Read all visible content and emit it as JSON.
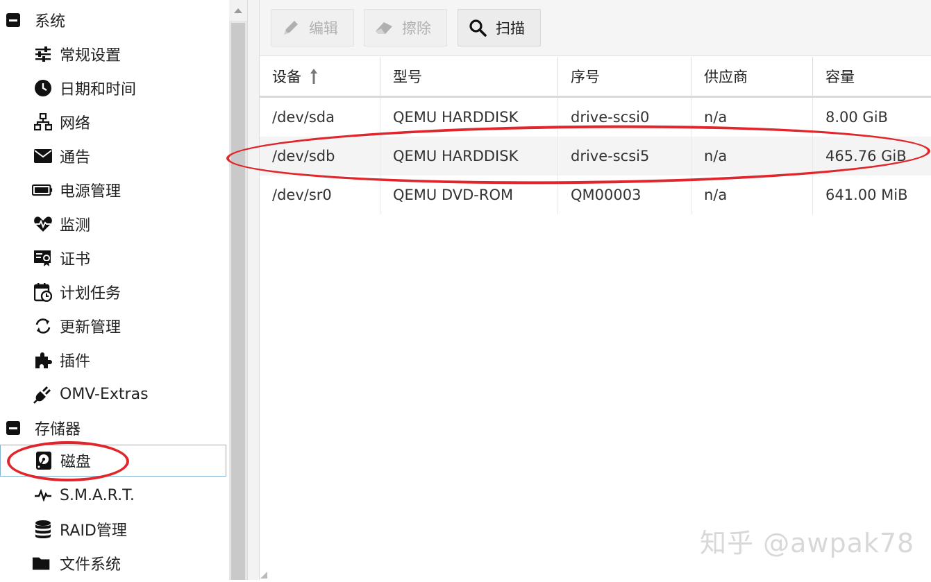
{
  "sidebar": {
    "groups": [
      {
        "label": "系统"
      },
      {
        "label": "存储器"
      }
    ],
    "system_items": [
      {
        "label": "常规设置",
        "icon": "sliders-icon"
      },
      {
        "label": "日期和时间",
        "icon": "clock-icon"
      },
      {
        "label": "网络",
        "icon": "network-icon"
      },
      {
        "label": "通告",
        "icon": "envelope-icon"
      },
      {
        "label": "电源管理",
        "icon": "battery-icon"
      },
      {
        "label": "监测",
        "icon": "heartbeat-icon"
      },
      {
        "label": "证书",
        "icon": "certificate-icon"
      },
      {
        "label": "计划任务",
        "icon": "calendar-clock-icon"
      },
      {
        "label": "更新管理",
        "icon": "refresh-icon"
      },
      {
        "label": "插件",
        "icon": "puzzle-icon"
      },
      {
        "label": "OMV-Extras",
        "icon": "plug-icon"
      }
    ],
    "storage_items": [
      {
        "label": "磁盘",
        "icon": "disk-icon",
        "selected": true
      },
      {
        "label": "S.M.A.R.T.",
        "icon": "pulse-icon"
      },
      {
        "label": "RAID管理",
        "icon": "database-icon"
      },
      {
        "label": "文件系统",
        "icon": "folder-icon"
      }
    ]
  },
  "toolbar": {
    "edit_label": "编辑",
    "wipe_label": "擦除",
    "scan_label": "扫描"
  },
  "table": {
    "columns": [
      "设备",
      "型号",
      "序号",
      "供应商",
      "容量"
    ],
    "sort_column": "设备",
    "rows": [
      {
        "device": "/dev/sda",
        "model": "QEMU HARDDISK",
        "serial": "drive-scsi0",
        "vendor": "n/a",
        "capacity": "8.00 GiB"
      },
      {
        "device": "/dev/sdb",
        "model": "QEMU HARDDISK",
        "serial": "drive-scsi5",
        "vendor": "n/a",
        "capacity": "465.76 GiB"
      },
      {
        "device": "/dev/sr0",
        "model": "QEMU DVD-ROM",
        "serial": "QM00003",
        "vendor": "n/a",
        "capacity": "641.00 MiB"
      }
    ]
  },
  "watermark": "知乎 @awpak78",
  "colors": {
    "annotation": "#e0262b",
    "selection_border": "#7fb3d5"
  }
}
